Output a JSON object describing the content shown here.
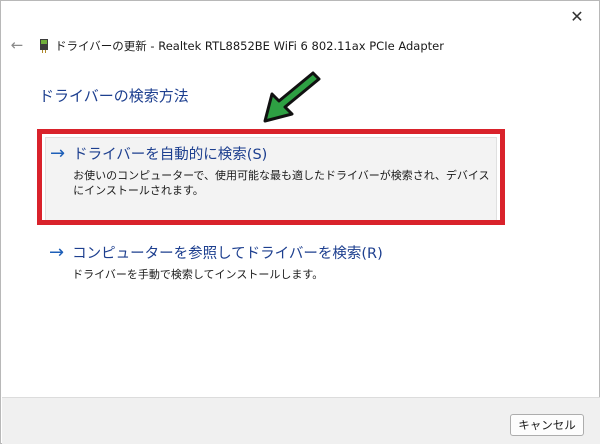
{
  "window": {
    "close_icon": "close-icon",
    "back_icon": "back-arrow-icon",
    "title": "ドライバーの更新 - Realtek RTL8852BE WiFi 6 802.11ax PCIe Adapter",
    "device_icon": "network-adapter-icon"
  },
  "main": {
    "heading": "ドライバーの検索方法",
    "options": [
      {
        "title": "ドライバーを自動的に検索(S)",
        "description": "お使いのコンピューターで、使用可能な最も適したドライバーが検索され、デバイスにインストールされます。",
        "highlighted": true
      },
      {
        "title": "コンピューターを参照してドライバーを検索(R)",
        "description": "ドライバーを手動で検索してインストールします。",
        "highlighted": false
      }
    ]
  },
  "annotation": {
    "arrow_color": "#2ea043",
    "box_color": "#d9222b"
  },
  "footer": {
    "cancel_label": "キャンセル"
  }
}
